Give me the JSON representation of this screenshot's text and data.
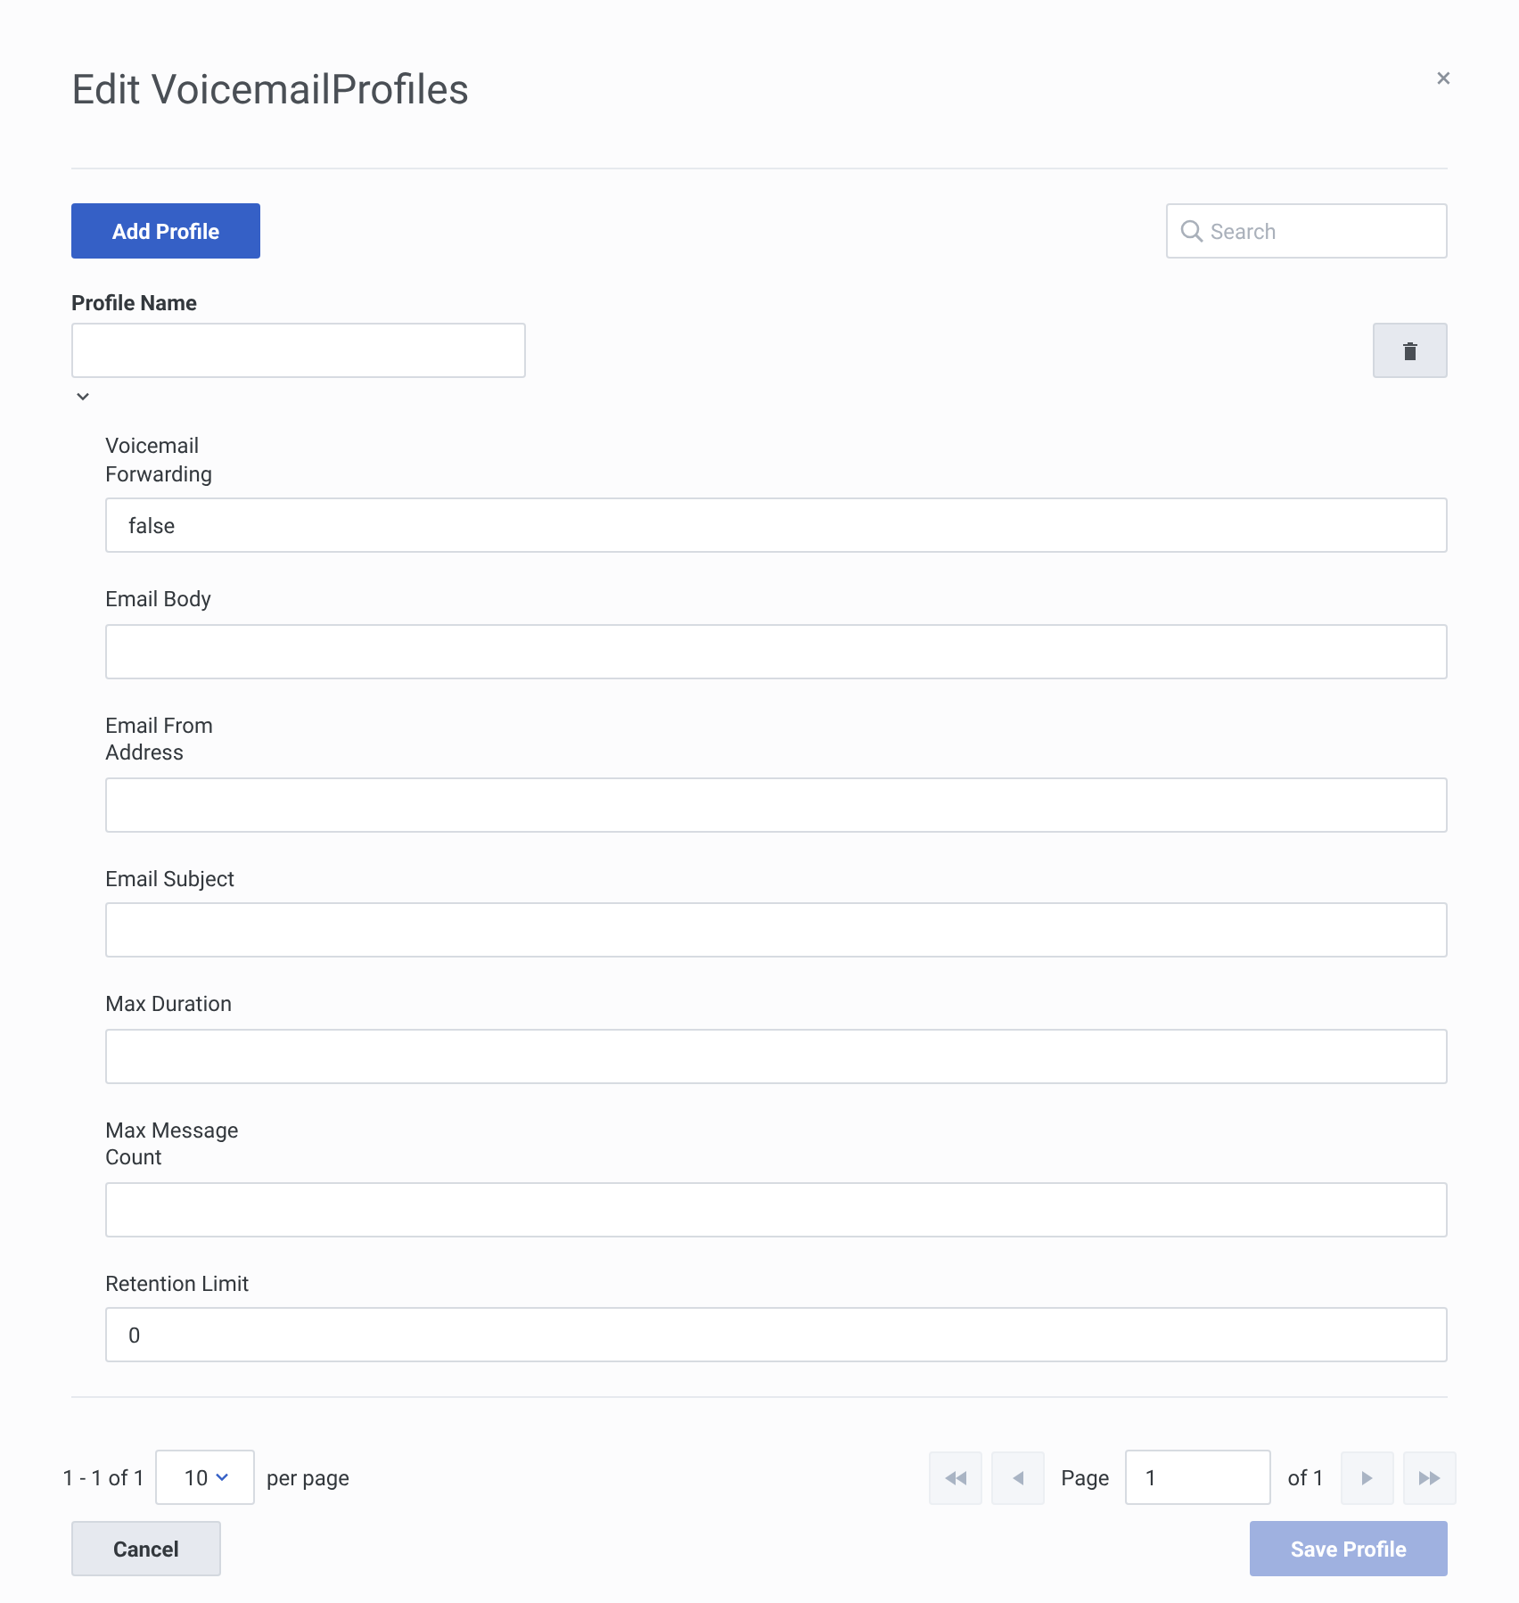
{
  "dialog": {
    "title": "Edit VoicemailProfiles",
    "close": "×"
  },
  "toolbar": {
    "add_button": "Add Profile",
    "search": {
      "placeholder": "Search"
    }
  },
  "profile": {
    "label": "Profile Name",
    "expanded": true,
    "fields": [
      {
        "label": "Voicemail Forwarding",
        "value": "false"
      },
      {
        "label": "Email Body"
      },
      {
        "label": "Email From Address"
      },
      {
        "label": "Email Subject"
      },
      {
        "label": "Max Duration"
      },
      {
        "label": "Max Message Count"
      },
      {
        "label": "Retention Limit",
        "value": "0"
      }
    ]
  },
  "pagination": {
    "range": "1 - 1 of 1",
    "per_page_value": "10",
    "per_page_label": "per page",
    "page_label": "Page",
    "page_value": "1",
    "of_label": "of 1",
    "nav": [
      {
        "kind": "first",
        "disabled": true
      },
      {
        "kind": "prev",
        "disabled": true
      },
      {
        "kind": "next",
        "disabled": true
      },
      {
        "kind": "last",
        "disabled": true
      }
    ]
  },
  "footer": {
    "cancel": "Cancel",
    "save": {
      "label": "Save Profile",
      "disabled": true
    }
  }
}
